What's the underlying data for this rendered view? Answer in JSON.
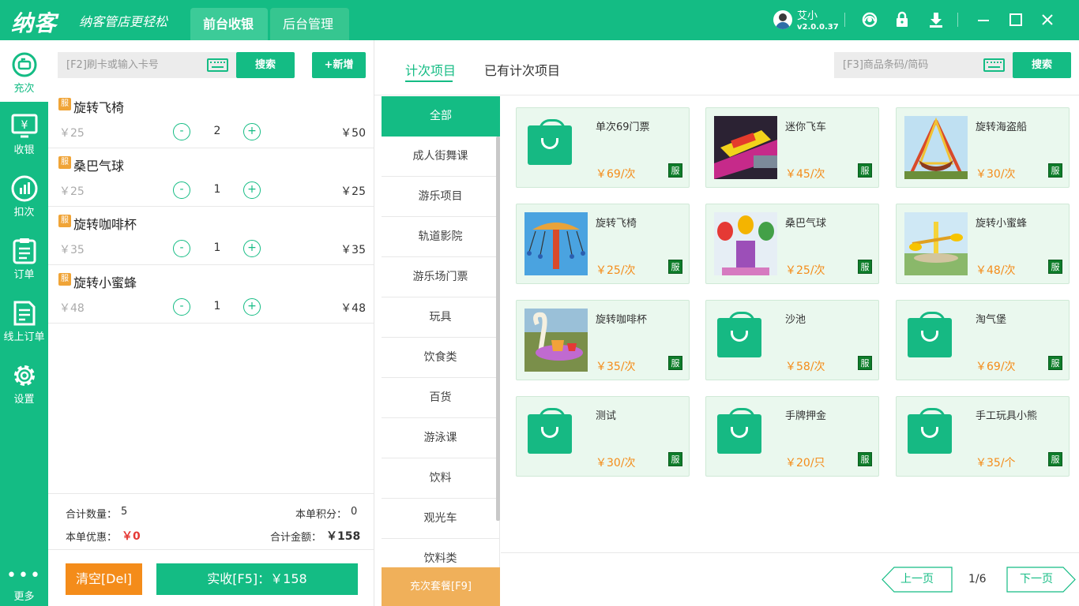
{
  "header": {
    "logo": "纳客",
    "slogan": "纳客管店更轻松",
    "tabs": [
      "前台收银",
      "后台管理"
    ],
    "user": "艾小",
    "version": "v2.0.0.37"
  },
  "sidebar": {
    "items": [
      "充次",
      "收银",
      "扣次",
      "订单",
      "线上订单",
      "设置"
    ],
    "more": "更多"
  },
  "cart": {
    "search_placeholder": "[F2]刷卡或输入卡号",
    "search_button": "搜索",
    "add_button": "+新增",
    "badge": "服",
    "items": [
      {
        "name": "旋转飞椅",
        "price": "￥25",
        "qty": "2",
        "subtotal": "￥50"
      },
      {
        "name": "桑巴气球",
        "price": "￥25",
        "qty": "1",
        "subtotal": "￥25"
      },
      {
        "name": "旋转咖啡杯",
        "price": "￥35",
        "qty": "1",
        "subtotal": "￥35"
      },
      {
        "name": "旋转小蜜蜂",
        "price": "￥48",
        "qty": "1",
        "subtotal": "￥48"
      }
    ],
    "minus": "-",
    "plus": "+",
    "total_qty_label": "合计数量：",
    "total_qty": "5",
    "points_label": "本单积分：",
    "points": "0",
    "discount_label": "本单优惠：",
    "discount": "￥0",
    "amount_label": "合计金额：",
    "amount": "￥158",
    "clear_button": "清空[Del]",
    "pay_button": "实收[F5]：￥158"
  },
  "products_panel": {
    "tabs": [
      "计次项目",
      "已有计次项目"
    ],
    "search_placeholder": "[F3]商品条码/简码",
    "search_button": "搜索",
    "categories": [
      "全部",
      "成人街舞课",
      "游乐项目",
      "轨道影院",
      "游乐场门票",
      "玩具",
      "饮食类",
      "百货",
      "游泳课",
      "饮料",
      "观光车",
      "饮料类"
    ],
    "package_button": "充次套餐[F9]",
    "badge": "服",
    "products": [
      {
        "name": "单次69门票",
        "price": "￥69/次",
        "image": "bag"
      },
      {
        "name": "迷你飞车",
        "price": "￥45/次",
        "image": "photo"
      },
      {
        "name": "旋转海盗船",
        "price": "￥30/次",
        "image": "photo"
      },
      {
        "name": "旋转飞椅",
        "price": "￥25/次",
        "image": "photo"
      },
      {
        "name": "桑巴气球",
        "price": "￥25/次",
        "image": "photo"
      },
      {
        "name": "旋转小蜜蜂",
        "price": "￥48/次",
        "image": "photo"
      },
      {
        "name": "旋转咖啡杯",
        "price": "￥35/次",
        "image": "photo"
      },
      {
        "name": "沙池",
        "price": "￥58/次",
        "image": "bag"
      },
      {
        "name": "淘气堡",
        "price": "￥69/次",
        "image": "bag"
      },
      {
        "name": "测试",
        "price": "￥30/次",
        "image": "bag"
      },
      {
        "name": "手牌押金",
        "price": "￥20/只",
        "image": "bag"
      },
      {
        "name": "手工玩具小熊",
        "price": "￥35/个",
        "image": "bag"
      }
    ],
    "pager": {
      "prev": "上一页",
      "page": "1/6",
      "next": "下一页"
    }
  }
}
